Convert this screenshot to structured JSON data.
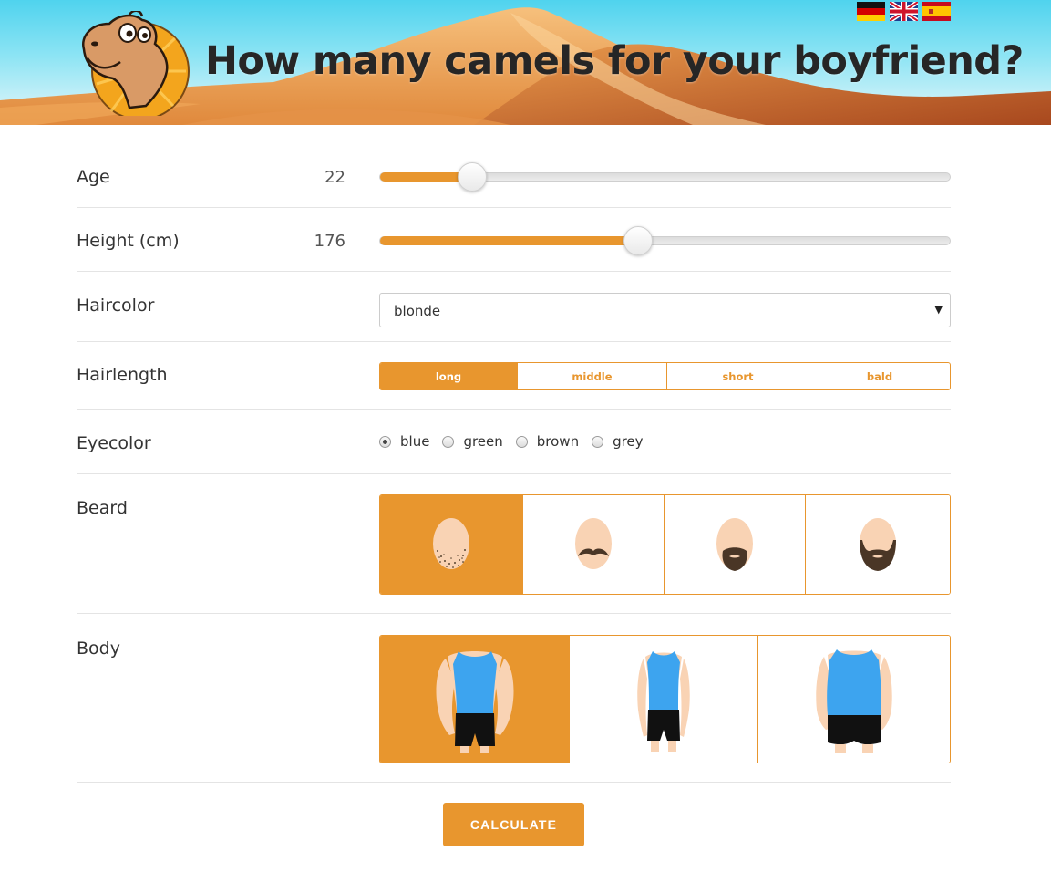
{
  "header": {
    "title": "How many camels for your boyfriend?",
    "flags": [
      "german-flag-icon",
      "uk-flag-icon",
      "spanish-flag-icon"
    ]
  },
  "form": {
    "age": {
      "label": "Age",
      "value": "22",
      "fraction": 0.16
    },
    "height": {
      "label": "Height (cm)",
      "value": "176",
      "fraction": 0.45
    },
    "haircolor": {
      "label": "Haircolor",
      "selected": "blonde"
    },
    "hairlength": {
      "label": "Hairlength",
      "options": [
        "long",
        "middle",
        "short",
        "bald"
      ],
      "selected": "long"
    },
    "eyecolor": {
      "label": "Eyecolor",
      "options": [
        "blue",
        "green",
        "brown",
        "grey"
      ],
      "selected": "blue"
    },
    "beard": {
      "label": "Beard",
      "options": [
        "stubble-icon",
        "mustache-icon",
        "goatee-icon",
        "full-beard-icon"
      ],
      "selected": 0
    },
    "body": {
      "label": "Body",
      "options": [
        "muscular-body-icon",
        "slim-body-icon",
        "heavy-body-icon"
      ],
      "selected": 0
    }
  },
  "calculate_label": "CALCULATE",
  "colors": {
    "accent": "#e8962e",
    "sky": "#4fd3ee",
    "skin": "#f9d3b4",
    "shirt": "#3da4ef"
  }
}
